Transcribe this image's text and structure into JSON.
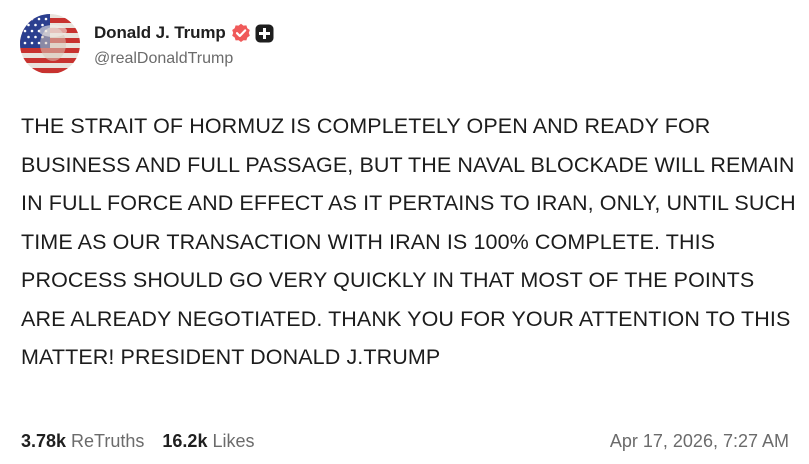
{
  "author": {
    "display_name": "Donald J. Trump",
    "handle": "@realDonaldTrump",
    "avatar_icon": "flag-portrait-avatar",
    "verified_icon": "verified-badge-icon",
    "verified_color": "#f05a5a",
    "subscriber_icon": "truth-plus-icon"
  },
  "post": {
    "text": "THE STRAIT OF HORMUZ IS COMPLETELY OPEN AND READY FOR BUSINESS AND FULL PASSAGE, BUT THE NAVAL BLOCKADE WILL REMAIN IN FULL FORCE AND EFFECT AS IT PERTAINS TO IRAN, ONLY, UNTIL SUCH TIME AS OUR TRANSACTION WITH IRAN IS 100% COMPLETE. THIS PROCESS SHOULD GO VERY QUICKLY IN THAT MOST OF THE POINTS ARE ALREADY NEGOTIATED. THANK YOU FOR YOUR ATTENTION TO THIS MATTER! PRESIDENT DONALD J.TRUMP"
  },
  "stats": {
    "retruths_count": "3.78k",
    "retruths_label": "ReTruths",
    "likes_count": "16.2k",
    "likes_label": "Likes",
    "timestamp": "Apr 17, 2026, 7:27 AM"
  }
}
